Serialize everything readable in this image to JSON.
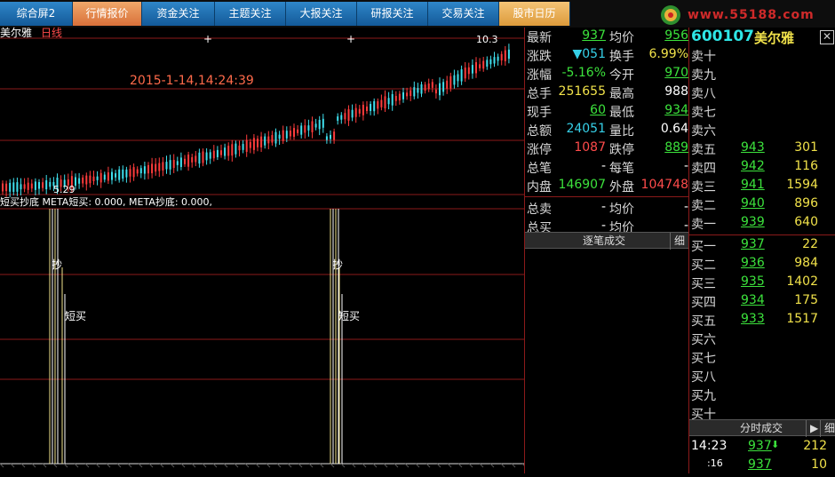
{
  "tabs": [
    {
      "label": "综合屏2",
      "style": "blue"
    },
    {
      "label": "行情报价",
      "style": "orange"
    },
    {
      "label": "资金关注",
      "style": "blue"
    },
    {
      "label": "主题关注",
      "style": "blue"
    },
    {
      "label": "大报关注",
      "style": "blue"
    },
    {
      "label": "研报关注",
      "style": "blue"
    },
    {
      "label": "交易关注",
      "style": "blue"
    },
    {
      "label": "股市日历",
      "style": "gold"
    }
  ],
  "logo_text": "www.55188.com",
  "chart": {
    "stock_name": "美尔雅",
    "period": "日线",
    "datetime": "2015-1-14,14:24:39",
    "high_label": "10.3",
    "low_label": "5.29",
    "indicator_line": "短买抄底 META短买: 0.000, META抄底: 0.000,",
    "signal_chao": "抄",
    "signal_duanmai": "短买"
  },
  "quote": {
    "code": "600107",
    "name": "美尔雅",
    "rows": [
      {
        "l1": "最新",
        "v1": "937",
        "c1": "green",
        "l2": "均价",
        "v2": "956",
        "c2": "green"
      },
      {
        "l1": "涨跌",
        "v1": "▼051",
        "c1": "cyan",
        "l2": "换手",
        "v2": "6.99%",
        "c2": "yellow"
      },
      {
        "l1": "涨幅",
        "v1": "-5.16%",
        "c1": "green",
        "l2": "今开",
        "v2": "970",
        "c2": "green"
      },
      {
        "l1": "总手",
        "v1": "251655",
        "c1": "yellow",
        "l2": "最高",
        "v2": "988",
        "c2": "white"
      },
      {
        "l1": "现手",
        "v1": "60",
        "c1": "green",
        "l2": "最低",
        "v2": "934",
        "c2": "green"
      },
      {
        "l1": "总额",
        "v1": "24051",
        "c1": "cyan",
        "l2": "量比",
        "v2": "0.64",
        "c2": "white"
      },
      {
        "l1": "涨停",
        "v1": "1087",
        "c1": "red",
        "l2": "跌停",
        "v2": "889",
        "c2": "green"
      },
      {
        "l1": "总笔",
        "v1": "-",
        "c1": "white",
        "l2": "每笔",
        "v2": "-",
        "c2": "white"
      },
      {
        "l1": "内盘",
        "v1": "146907",
        "c1": "green",
        "l2": "外盘",
        "v2": "104748",
        "c2": "red"
      },
      {
        "l1": "总卖",
        "v1": "-",
        "c1": "white",
        "l2": "均价",
        "v2": "-",
        "c2": "white"
      },
      {
        "l1": "总买",
        "v1": "-",
        "c1": "white",
        "l2": "均价",
        "v2": "-",
        "c2": "white"
      }
    ],
    "trade_header": "逐笔成交",
    "detail_btn": "细"
  },
  "book": {
    "sell": [
      {
        "label": "卖十",
        "price": "",
        "vol": ""
      },
      {
        "label": "卖九",
        "price": "",
        "vol": ""
      },
      {
        "label": "卖八",
        "price": "",
        "vol": ""
      },
      {
        "label": "卖七",
        "price": "",
        "vol": ""
      },
      {
        "label": "卖六",
        "price": "",
        "vol": ""
      },
      {
        "label": "卖五",
        "price": "943",
        "vol": "301"
      },
      {
        "label": "卖四",
        "price": "942",
        "vol": "116"
      },
      {
        "label": "卖三",
        "price": "941",
        "vol": "1594"
      },
      {
        "label": "卖二",
        "price": "940",
        "vol": "896"
      },
      {
        "label": "卖一",
        "price": "939",
        "vol": "640"
      }
    ],
    "buy": [
      {
        "label": "买一",
        "price": "937",
        "vol": "22"
      },
      {
        "label": "买二",
        "price": "936",
        "vol": "984"
      },
      {
        "label": "买三",
        "price": "935",
        "vol": "1402"
      },
      {
        "label": "买四",
        "price": "934",
        "vol": "175"
      },
      {
        "label": "买五",
        "price": "933",
        "vol": "1517"
      },
      {
        "label": "买六",
        "price": "",
        "vol": ""
      },
      {
        "label": "买七",
        "price": "",
        "vol": ""
      },
      {
        "label": "买八",
        "price": "",
        "vol": ""
      },
      {
        "label": "买九",
        "price": "",
        "vol": ""
      },
      {
        "label": "买十",
        "price": "",
        "vol": ""
      }
    ],
    "ticks_header": "分时成交",
    "play_icon": "▶",
    "detail_btn": "细",
    "ticks": [
      {
        "time": "14:23",
        "price": "937",
        "arrow": "⬇",
        "vol": "212"
      },
      {
        "time": ":16",
        "price": "937",
        "arrow": "",
        "vol": "10"
      }
    ]
  },
  "colors": {
    "up": "#ff3c3c",
    "down": "#3fe0ee",
    "grid": "#8b1a1a",
    "signal": "#f2e58c"
  }
}
